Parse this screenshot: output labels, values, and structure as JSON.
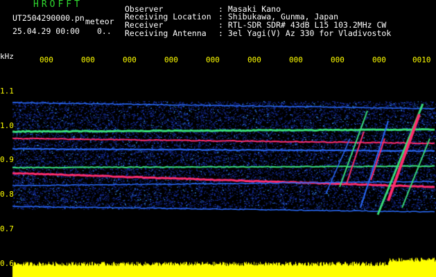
{
  "header": {
    "app_title": "HROFFT",
    "file_name": "UT2504290000.pn",
    "mode": "meteor",
    "datetime": "25.04.29 00:00",
    "dots": "0.."
  },
  "station_info": [
    {
      "label": "Observer",
      "value": ": Masaki Kano"
    },
    {
      "label": "Receiving Location",
      "value": ": Shibukawa, Gunma, Japan"
    },
    {
      "label": "Receiver",
      "value": ": RTL-SDR SDR# 43dB L15 103.2MHz CW"
    },
    {
      "label": "Receiving Antenna",
      "value": ": 3el Yagi(V) Az 330 for Vladivostok"
    }
  ],
  "axes": {
    "y_unit": "kHz",
    "y_ticks": [
      "1.1",
      "1.0",
      "0.9",
      "0.8",
      "0.7",
      "0.6"
    ],
    "x_ticks": [
      "000",
      "000",
      "000",
      "000",
      "000",
      "000",
      "000",
      "000",
      "000",
      "0010"
    ]
  },
  "colors": {
    "background": "#000000",
    "tick_text": "#ffff00",
    "title_text": "#2fd82f",
    "info_text": "#ffffff",
    "signal_strong": "#ff2d6e",
    "signal_mid": "#39e07a",
    "noise": "#1e3cc8",
    "audio_level": "#ffff00"
  }
}
